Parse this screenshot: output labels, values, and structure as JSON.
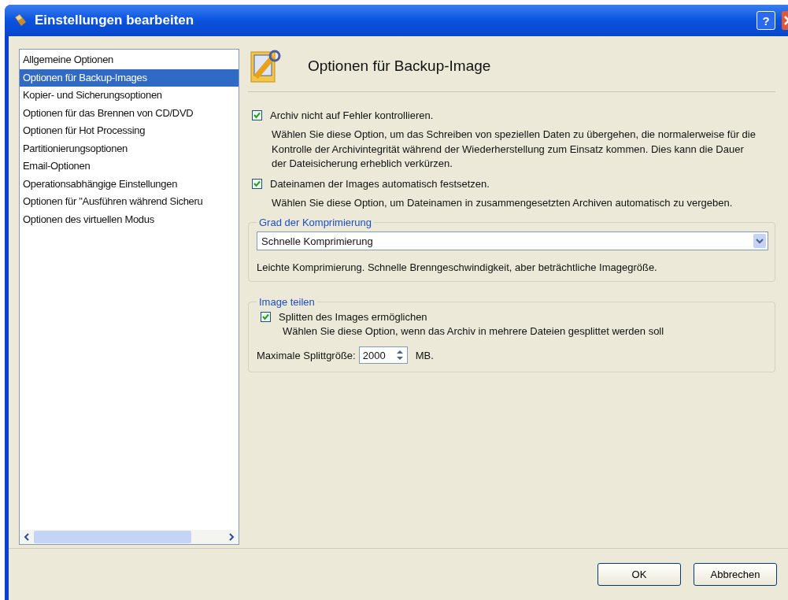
{
  "window": {
    "title": "Einstellungen bearbeiten",
    "help": "?"
  },
  "sidebar": {
    "items": [
      {
        "label": "Allgemeine Optionen",
        "selected": false
      },
      {
        "label": "Optionen für Backup-Images",
        "selected": true
      },
      {
        "label": "Kopier- und Sicherungsoptionen",
        "selected": false
      },
      {
        "label": "Optionen für das Brennen von CD/DVD",
        "selected": false
      },
      {
        "label": "Optionen für Hot Processing",
        "selected": false
      },
      {
        "label": "Partitionierungsoptionen",
        "selected": false
      },
      {
        "label": "Email-Optionen",
        "selected": false
      },
      {
        "label": "Operationsabhängige Einstellungen",
        "selected": false
      },
      {
        "label": "Optionen für \"Ausführen während Sicheru",
        "selected": false
      },
      {
        "label": "Optionen des virtuellen Modus",
        "selected": false
      }
    ]
  },
  "header": {
    "title": "Optionen für Backup-Image"
  },
  "options": [
    {
      "label": "Archiv nicht auf Fehler kontrollieren.",
      "checked": true,
      "description": "Wählen Sie diese Option, um das Schreiben von speziellen Daten zu übergehen, die normalerweise für die Kontrolle der Archivintegrität während der Wiederherstellung zum Einsatz kommen. Dies kann die Dauer der Dateisicherung erheblich verkürzen."
    },
    {
      "label": "Dateinamen der Images automatisch festsetzen.",
      "checked": true,
      "description": "Wählen Sie diese Option, um Dateinamen in zusammengesetzten Archiven automatisch zu vergeben."
    }
  ],
  "compression": {
    "legend": "Grad der Komprimierung",
    "value": "Schnelle Komprimierung",
    "description": "Leichte Komprimierung. Schnelle Brenngeschwindigkeit, aber beträchtliche Imagegröße."
  },
  "split": {
    "legend": "Image teilen",
    "option": {
      "label": "Splitten des Images ermöglichen",
      "checked": true,
      "description": "Wählen Sie diese Option, wenn das Archiv in mehrere Dateien gesplittet werden soll"
    },
    "size_label": "Maximale Splittgröße:",
    "size_value": "2000",
    "unit": "MB."
  },
  "buttons": [
    "OK",
    "Abbrechen"
  ]
}
